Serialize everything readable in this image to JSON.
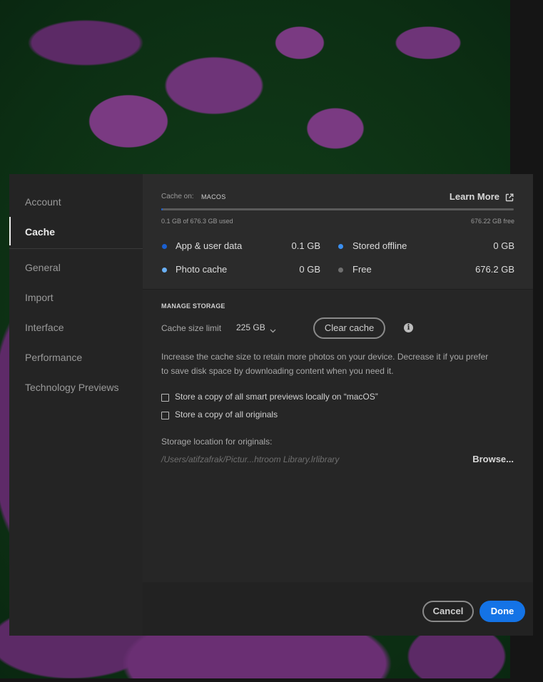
{
  "sidebar": {
    "items": [
      {
        "label": "Account"
      },
      {
        "label": "Cache"
      },
      {
        "label": "General"
      },
      {
        "label": "Import"
      },
      {
        "label": "Interface"
      },
      {
        "label": "Performance"
      },
      {
        "label": "Technology Previews"
      }
    ],
    "active": "Cache"
  },
  "cache": {
    "cache_on_label": "Cache on:",
    "cache_on_value": "MACOS",
    "learn_more": "Learn More",
    "used_text": "0.1 GB of 676.3 GB used",
    "free_text": "676.22 GB free",
    "used_fraction": 0.0002,
    "legend": [
      {
        "label": "App & user data",
        "value": "0.1 GB",
        "color": "#1a5fd0"
      },
      {
        "label": "Stored offline",
        "value": "0 GB",
        "color": "#3a8ff0"
      },
      {
        "label": "Photo cache",
        "value": "0 GB",
        "color": "#6ab0f5"
      },
      {
        "label": "Free",
        "value": "676.2 GB",
        "color": "#6f6f6f"
      }
    ]
  },
  "manage": {
    "heading": "MANAGE STORAGE",
    "size_limit_label": "Cache size limit",
    "size_limit_value": "225 GB",
    "clear_cache": "Clear cache",
    "description_line1": "Increase the cache size to retain more photos on your device. Decrease it if you prefer",
    "description_line2": "to save disk space by downloading content when you need it.",
    "checkbox_smart": "Store a copy of all smart previews locally on “macOS”",
    "checkbox_originals": "Store a copy of all originals",
    "storage_location_label": "Storage location for originals:",
    "storage_location_path": "/Users/atifzafrak/Pictur...htroom Library.lrlibrary",
    "browse": "Browse..."
  },
  "footer": {
    "cancel": "Cancel",
    "done": "Done"
  },
  "colors": {
    "accent": "#1473e6"
  }
}
